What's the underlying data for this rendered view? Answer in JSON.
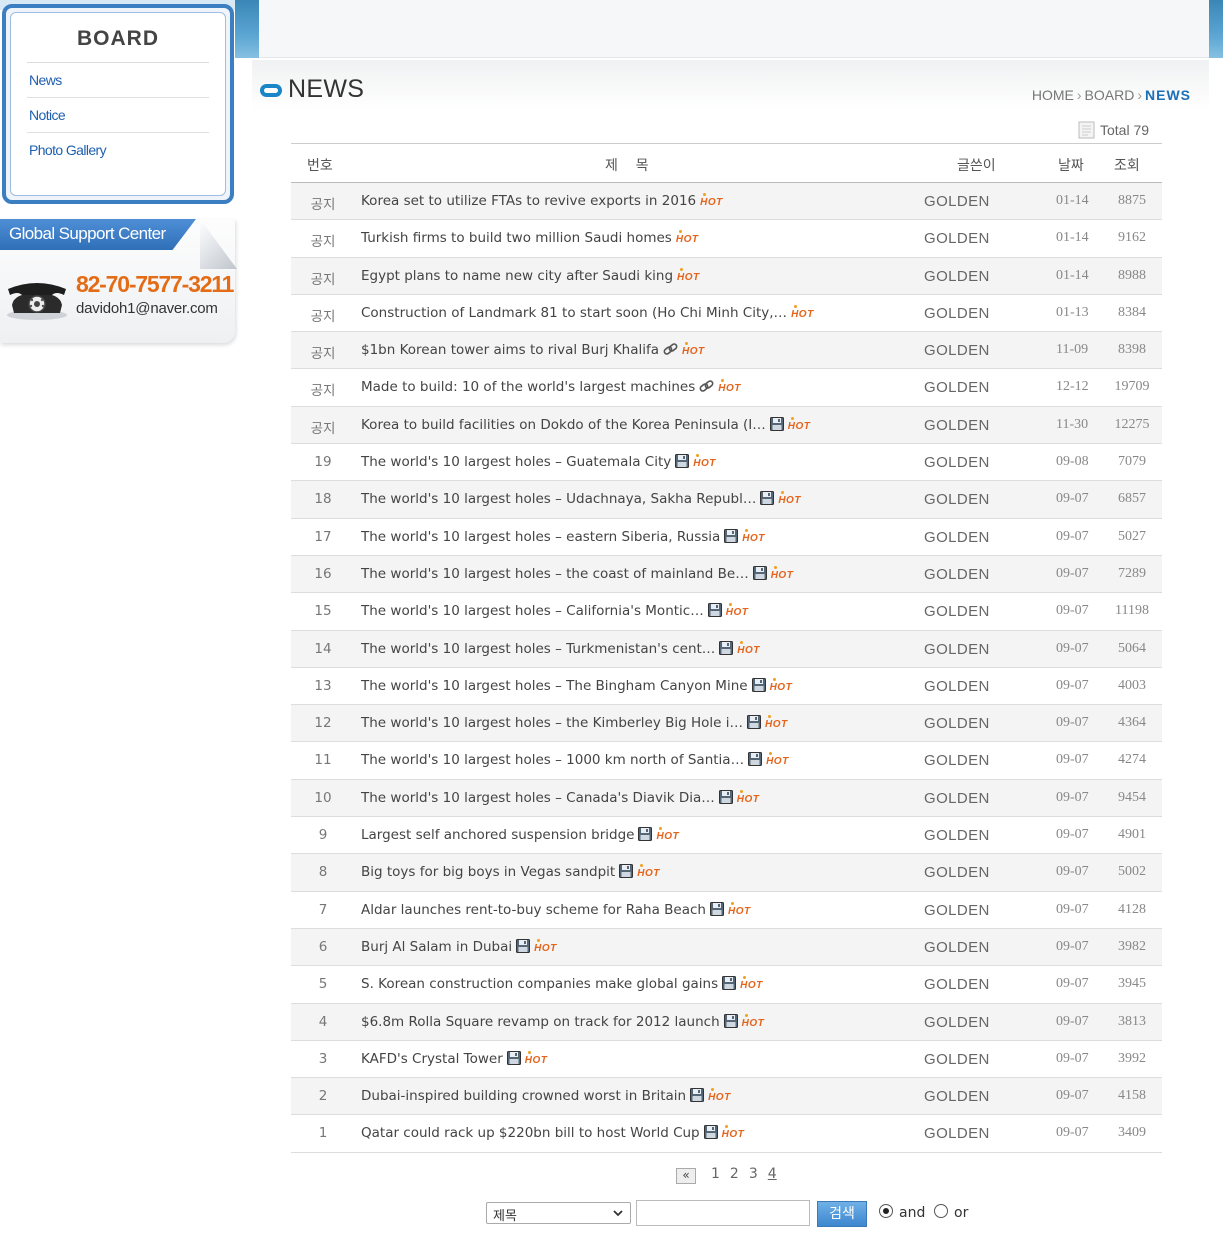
{
  "sidebar": {
    "title": "BOARD",
    "items": [
      {
        "label": "News"
      },
      {
        "label": "Notice"
      },
      {
        "label": "Photo Gallery"
      }
    ]
  },
  "support": {
    "banner": "Global Support Center",
    "phone": "82-70-7577-3211",
    "email": "davidoh1@naver.com"
  },
  "page": {
    "title": "NEWS",
    "breadcrumb": {
      "home": "HOME",
      "board": "BOARD",
      "current": "NEWS",
      "separator": "›"
    },
    "total_label": "Total",
    "total_value": "79"
  },
  "table": {
    "headers": {
      "num": "번호",
      "title": "제    목",
      "author": "글쓴이",
      "date": "날짜",
      "views": "조회"
    },
    "hot_label": "HOT",
    "rows": [
      {
        "num": "공지",
        "title": "Korea set to utilize FTAs to revive exports in 2016",
        "icon": "",
        "author": "GOLDEN",
        "date": "01-14",
        "views": "8875"
      },
      {
        "num": "공지",
        "title": "Turkish firms to build two million Saudi homes",
        "icon": "",
        "author": "GOLDEN",
        "date": "01-14",
        "views": "9162"
      },
      {
        "num": "공지",
        "title": "Egypt plans to name new city after Saudi king",
        "icon": "",
        "author": "GOLDEN",
        "date": "01-14",
        "views": "8988"
      },
      {
        "num": "공지",
        "title": "Construction of Landmark 81 to start soon (Ho Chi Minh City,…",
        "icon": "",
        "author": "GOLDEN",
        "date": "01-13",
        "views": "8384"
      },
      {
        "num": "공지",
        "title": "$1bn Korean tower aims to rival Burj Khalifa",
        "icon": "link",
        "author": "GOLDEN",
        "date": "11-09",
        "views": "8398"
      },
      {
        "num": "공지",
        "title": "Made to build: 10 of the world's largest machines",
        "icon": "link",
        "author": "GOLDEN",
        "date": "12-12",
        "views": "19709"
      },
      {
        "num": "공지",
        "title": "Korea to build facilities on Dokdo of the Korea Peninsula (I…",
        "icon": "disk",
        "author": "GOLDEN",
        "date": "11-30",
        "views": "12275"
      },
      {
        "num": "19",
        "title": "The world's 10 largest holes – Guatemala City",
        "icon": "disk",
        "author": "GOLDEN",
        "date": "09-08",
        "views": "7079"
      },
      {
        "num": "18",
        "title": "The world's 10 largest holes – Udachnaya, Sakha Republ…",
        "icon": "disk",
        "author": "GOLDEN",
        "date": "09-07",
        "views": "6857"
      },
      {
        "num": "17",
        "title": "The world's 10 largest holes – eastern Siberia, Russia",
        "icon": "disk",
        "author": "GOLDEN",
        "date": "09-07",
        "views": "5027"
      },
      {
        "num": "16",
        "title": "The world's 10 largest holes – the coast of mainland Be…",
        "icon": "disk",
        "author": "GOLDEN",
        "date": "09-07",
        "views": "7289"
      },
      {
        "num": "15",
        "title": "The world's 10 largest holes – California's Montic…",
        "icon": "disk",
        "author": "GOLDEN",
        "date": "09-07",
        "views": "11198"
      },
      {
        "num": "14",
        "title": "The world's 10 largest holes – Turkmenistan's cent…",
        "icon": "disk",
        "author": "GOLDEN",
        "date": "09-07",
        "views": "5064"
      },
      {
        "num": "13",
        "title": "The world's 10 largest holes – The Bingham Canyon Mine",
        "icon": "disk",
        "author": "GOLDEN",
        "date": "09-07",
        "views": "4003"
      },
      {
        "num": "12",
        "title": "The world's 10 largest holes – the Kimberley Big Hole i…",
        "icon": "disk",
        "author": "GOLDEN",
        "date": "09-07",
        "views": "4364"
      },
      {
        "num": "11",
        "title": "The world's 10 largest holes – 1000 km north of Santia…",
        "icon": "disk",
        "author": "GOLDEN",
        "date": "09-07",
        "views": "4274"
      },
      {
        "num": "10",
        "title": "The world's 10 largest holes – Canada's Diavik Dia…",
        "icon": "disk",
        "author": "GOLDEN",
        "date": "09-07",
        "views": "9454"
      },
      {
        "num": "9",
        "title": "Largest self anchored suspension bridge",
        "icon": "disk",
        "author": "GOLDEN",
        "date": "09-07",
        "views": "4901"
      },
      {
        "num": "8",
        "title": "Big toys for big boys in Vegas sandpit",
        "icon": "disk",
        "author": "GOLDEN",
        "date": "09-07",
        "views": "5002"
      },
      {
        "num": "7",
        "title": "Aldar launches rent-to-buy scheme for Raha Beach",
        "icon": "disk",
        "author": "GOLDEN",
        "date": "09-07",
        "views": "4128"
      },
      {
        "num": "6",
        "title": "Burj Al Salam in Dubai",
        "icon": "disk",
        "author": "GOLDEN",
        "date": "09-07",
        "views": "3982"
      },
      {
        "num": "5",
        "title": "S. Korean construction companies make global gains",
        "icon": "disk",
        "author": "GOLDEN",
        "date": "09-07",
        "views": "3945"
      },
      {
        "num": "4",
        "title": "$6.8m Rolla Square revamp on track for 2012 launch",
        "icon": "disk",
        "author": "GOLDEN",
        "date": "09-07",
        "views": "3813"
      },
      {
        "num": "3",
        "title": "KAFD's Crystal Tower",
        "icon": "disk",
        "author": "GOLDEN",
        "date": "09-07",
        "views": "3992"
      },
      {
        "num": "2",
        "title": "Dubai-inspired building crowned worst in Britain",
        "icon": "disk",
        "author": "GOLDEN",
        "date": "09-07",
        "views": "4158"
      },
      {
        "num": "1",
        "title": "Qatar could rack up $220bn bill to host World Cup",
        "icon": "disk",
        "author": "GOLDEN",
        "date": "09-07",
        "views": "3409"
      }
    ]
  },
  "pagination": {
    "prev_label": "«",
    "pages": [
      "1",
      "2",
      "3",
      "4"
    ],
    "current": "4"
  },
  "search": {
    "field_selected": "제목",
    "query": "",
    "button_label": "검색",
    "mode_and": "and",
    "mode_or": "or",
    "mode_selected": "and"
  },
  "colors": {
    "accent": "#1a6fb8",
    "hot": "#e4641c",
    "phone": "#e36c16",
    "sidebar_border": "#3b7ec2"
  }
}
